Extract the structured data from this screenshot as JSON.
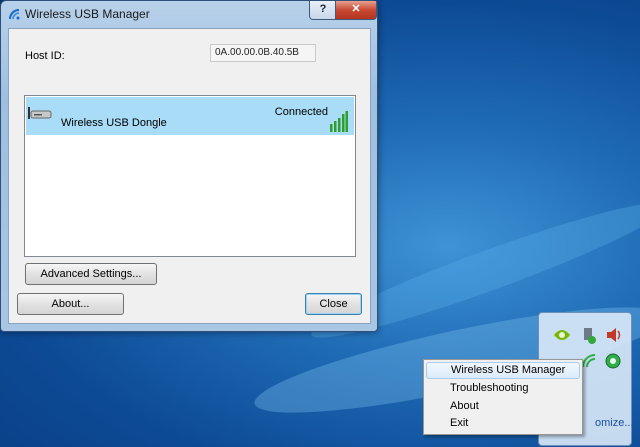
{
  "window": {
    "title": "Wireless USB Manager",
    "help_label": "?",
    "close_label": "✕",
    "host_label": "Host ID:",
    "host_value": "0A.00.00.0B.40.5B",
    "device": {
      "name": "Wireless USB Dongle",
      "status": "Connected",
      "signal_bars": 5
    },
    "advanced_label": "Advanced Settings...",
    "about_label": "About...",
    "close_button_label": "Close"
  },
  "tray": {
    "customize_label": "omize..."
  },
  "context_menu": {
    "items": [
      "Wireless USB Manager",
      "Troubleshooting",
      "About",
      "Exit"
    ]
  },
  "colors": {
    "selection": "#a8dcf7",
    "signal": "#2f9e2f",
    "desktop": "#1f6bb5"
  }
}
